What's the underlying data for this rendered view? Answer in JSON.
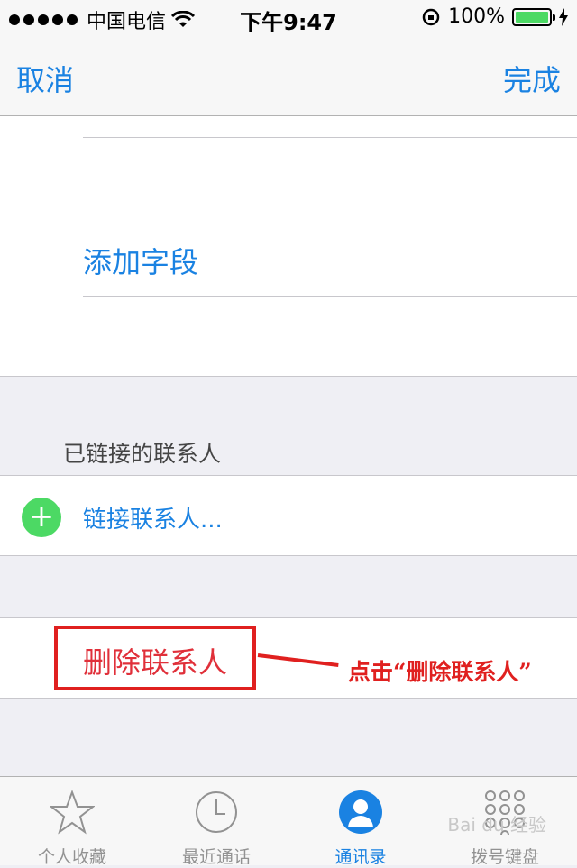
{
  "status_bar": {
    "carrier": "中国电信",
    "time": "下午9:47",
    "battery": "100%"
  },
  "nav": {
    "cancel": "取消",
    "done": "完成"
  },
  "fields": {
    "add_field": "添加字段"
  },
  "linked": {
    "header": "已链接的联系人",
    "link_contact": "链接联系人..."
  },
  "delete": {
    "label": "删除联系人"
  },
  "annotation": {
    "text": "点击“删除联系人”"
  },
  "tabs": [
    {
      "label": "个人收藏",
      "icon": "star-icon"
    },
    {
      "label": "最近通话",
      "icon": "clock-icon"
    },
    {
      "label": "通讯录",
      "icon": "contacts-icon"
    },
    {
      "label": "拨号键盘",
      "icon": "keypad-icon"
    }
  ],
  "watermark": "Bai du 经验",
  "colors": {
    "accent": "#1a82e2",
    "destructive": "#e0303a",
    "annotation": "#e0201f",
    "add_green": "#4cd964"
  }
}
